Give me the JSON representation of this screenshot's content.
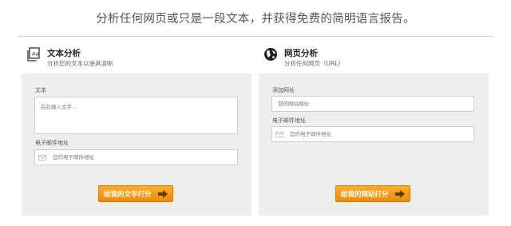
{
  "header": {
    "headline": "分析任何网页或只是一段文本，并获得免费的简明语言报告。"
  },
  "text_analysis": {
    "icon": "text-document-icon",
    "title": "文本分析",
    "subtitle": "分析您的文本以使其清晰",
    "text_label": "文本",
    "text_placeholder": "在此输入文字...",
    "email_label": "电子邮件地址",
    "email_placeholder": "您的电子邮件地址",
    "button_label": "给我的文字打分"
  },
  "web_analysis": {
    "icon": "globe-icon",
    "title": "网页分析",
    "subtitle": "分析任何网页（URL）",
    "url_label": "添加网址",
    "url_placeholder": "您的网站网址",
    "email_label": "电子邮件地址",
    "email_placeholder": "您的电子邮件地址",
    "button_label": "给我的网站打分"
  },
  "colors": {
    "button": "#f5960f",
    "panel": "#eeeeee",
    "divider": "#cfcfcf"
  }
}
